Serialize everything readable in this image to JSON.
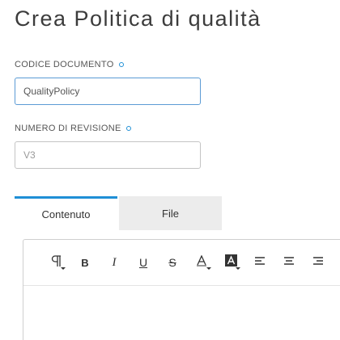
{
  "page": {
    "title": "Crea Politica di qualità"
  },
  "fields": {
    "document_code": {
      "label": "CODICE DOCUMENTO",
      "value": "QualityPolicy",
      "placeholder": ""
    },
    "revision_number": {
      "label": "NUMERO DI REVISIONE",
      "value": "",
      "placeholder": "V3"
    }
  },
  "tabs": [
    {
      "label": "Contenuto",
      "active": true
    },
    {
      "label": "File",
      "active": false
    }
  ],
  "toolbar": {
    "icons": [
      "paragraph-format-icon",
      "bold-icon",
      "italic-icon",
      "underline-icon",
      "strikethrough-icon",
      "font-color-icon",
      "background-color-icon",
      "align-left-icon",
      "align-center-icon",
      "align-right-icon"
    ],
    "bold_glyph": "B",
    "italic_glyph": "I",
    "underline_glyph": "U",
    "strike_glyph": "S"
  },
  "colors": {
    "accent": "#1f8fd6",
    "tab_inactive_bg": "#ececec"
  }
}
